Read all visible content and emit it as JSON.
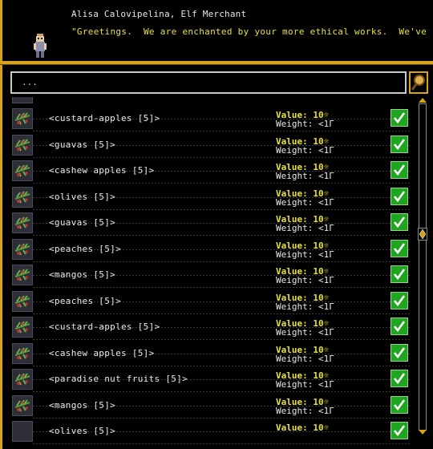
{
  "merchant": {
    "name": "Alisa Calovipelina, Elf Merchant",
    "greeting": "\"Greetings.  We are enchanted by your more ethical works.  We've co"
  },
  "search": {
    "value": "...",
    "button_icon": "magnifier-icon"
  },
  "items": [
    {
      "name": "<custard-apples [5]>",
      "value": "Value: 10☼",
      "weight": "Weight: <1Γ",
      "checked": true
    },
    {
      "name": "<guavas [5]>",
      "value": "Value: 10☼",
      "weight": "Weight: <1Γ",
      "checked": true
    },
    {
      "name": "<cashew apples [5]>",
      "value": "Value: 10☼",
      "weight": "Weight: <1Γ",
      "checked": true
    },
    {
      "name": "<olives [5]>",
      "value": "Value: 10☼",
      "weight": "Weight: <1Γ",
      "checked": true
    },
    {
      "name": "<guavas [5]>",
      "value": "Value: 10☼",
      "weight": "Weight: <1Γ",
      "checked": true
    },
    {
      "name": "<peaches [5]>",
      "value": "Value: 10☼",
      "weight": "Weight: <1Γ",
      "checked": true
    },
    {
      "name": "<mangos [5]>",
      "value": "Value: 10☼",
      "weight": "Weight: <1Γ",
      "checked": true
    },
    {
      "name": "<peaches [5]>",
      "value": "Value: 10☼",
      "weight": "Weight: <1Γ",
      "checked": true
    },
    {
      "name": "<custard-apples [5]>",
      "value": "Value: 10☼",
      "weight": "Weight: <1Γ",
      "checked": true
    },
    {
      "name": "<cashew apples [5]>",
      "value": "Value: 10☼",
      "weight": "Weight: <1Γ",
      "checked": true
    },
    {
      "name": "<paradise nut fruits [5]>",
      "value": "Value: 10☼",
      "weight": "Weight: <1Γ",
      "checked": true
    },
    {
      "name": "<mangos [5]>",
      "value": "Value: 10☼",
      "weight": "Weight: <1Γ",
      "checked": true
    },
    {
      "name": "<olives [5]>",
      "value": "Value: 10☼",
      "weight": "",
      "checked": true
    }
  ],
  "colors": {
    "frame": "#d9a21b",
    "value_text": "#e9e236",
    "check_green": "#1fa51f"
  },
  "icons": {
    "item": "fruit-sprite-icon",
    "check": "checkmark-icon",
    "scroll_up": "scroll-up-arrow-icon",
    "scroll_down": "scroll-down-arrow-icon"
  }
}
